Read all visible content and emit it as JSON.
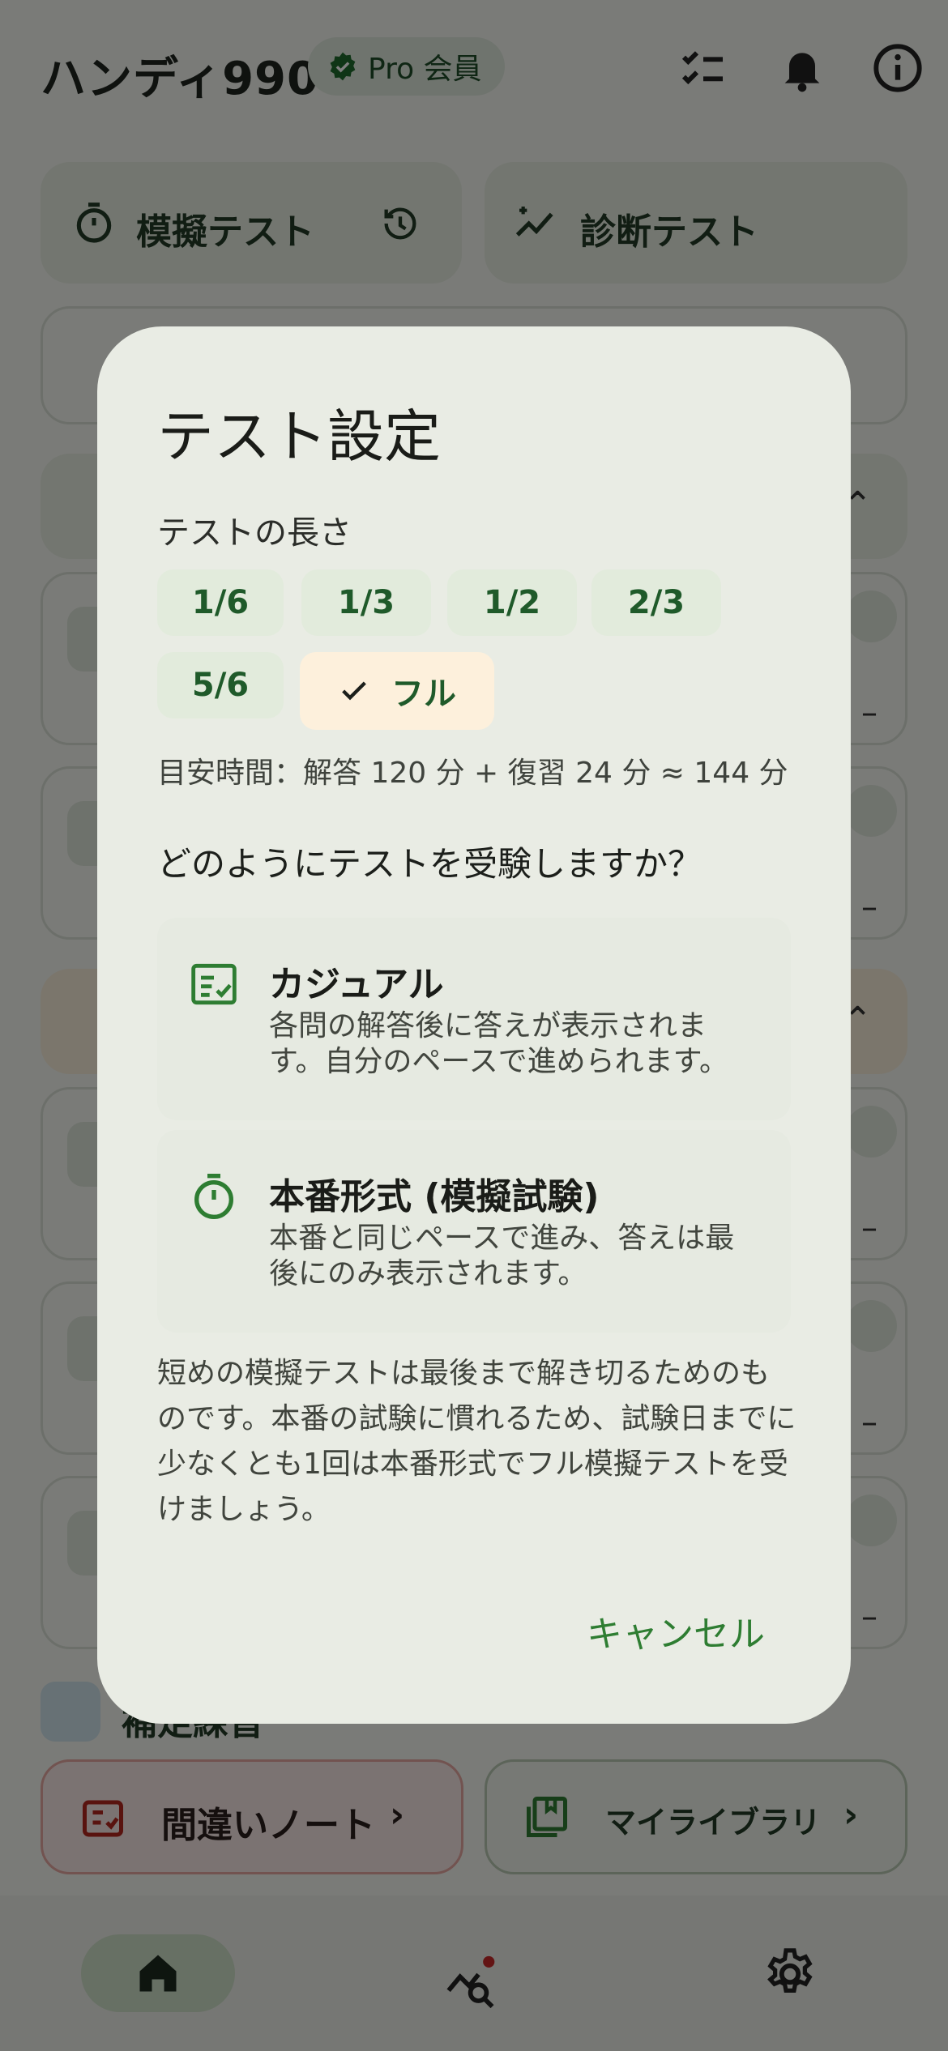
{
  "app": {
    "title": "ハンディ990",
    "pro_badge": "Pro 会員",
    "header_icons": [
      "checklist-icon",
      "bell-icon",
      "info-icon"
    ]
  },
  "home": {
    "mock_test_label": "模擬テスト",
    "diagnostic_label": "診断テスト",
    "error_note_label": "間違いノート",
    "library_label": "マイライブラリ",
    "section_bottom_label": "補足練習"
  },
  "dialog": {
    "title": "テスト設定",
    "length_label": "テストの長さ",
    "length_options": [
      "1/6",
      "1/3",
      "1/2",
      "2/3",
      "5/6",
      "フル"
    ],
    "selected_length": "フル",
    "estimate": "目安時間：解答 120 分 + 復習 24 分 ≈ 144 分",
    "question": "どのようにテストを受験しますか？",
    "modes": [
      {
        "title": "カジュアル",
        "description": "各問の解答後に答えが表示されます。自分のペースで進められます。"
      },
      {
        "title": "本番形式 (模擬試験)",
        "description": "本番と同じペースで進み、答えは最後にのみ表示されます。"
      }
    ],
    "note": "短めの模擬テストは最後まで解き切るためのものです。本番の試験に慣れるため、試験日までに少なくとも1回は本番形式でフル模擬テストを受けましょう。",
    "cancel_label": "キャンセル"
  },
  "colors": {
    "accent_green": "#2e7d32",
    "selected_chip": "#fdf0dc",
    "scrim": "rgba(0,0,0,0.5)"
  }
}
